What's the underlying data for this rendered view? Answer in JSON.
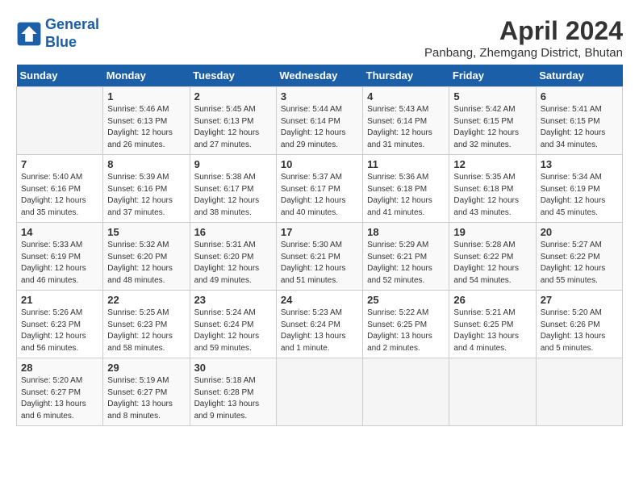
{
  "header": {
    "logo_line1": "General",
    "logo_line2": "Blue",
    "month": "April 2024",
    "location": "Panbang, Zhemgang District, Bhutan"
  },
  "weekdays": [
    "Sunday",
    "Monday",
    "Tuesday",
    "Wednesday",
    "Thursday",
    "Friday",
    "Saturday"
  ],
  "weeks": [
    [
      {
        "day": "",
        "info": ""
      },
      {
        "day": "1",
        "info": "Sunrise: 5:46 AM\nSunset: 6:13 PM\nDaylight: 12 hours\nand 26 minutes."
      },
      {
        "day": "2",
        "info": "Sunrise: 5:45 AM\nSunset: 6:13 PM\nDaylight: 12 hours\nand 27 minutes."
      },
      {
        "day": "3",
        "info": "Sunrise: 5:44 AM\nSunset: 6:14 PM\nDaylight: 12 hours\nand 29 minutes."
      },
      {
        "day": "4",
        "info": "Sunrise: 5:43 AM\nSunset: 6:14 PM\nDaylight: 12 hours\nand 31 minutes."
      },
      {
        "day": "5",
        "info": "Sunrise: 5:42 AM\nSunset: 6:15 PM\nDaylight: 12 hours\nand 32 minutes."
      },
      {
        "day": "6",
        "info": "Sunrise: 5:41 AM\nSunset: 6:15 PM\nDaylight: 12 hours\nand 34 minutes."
      }
    ],
    [
      {
        "day": "7",
        "info": "Sunrise: 5:40 AM\nSunset: 6:16 PM\nDaylight: 12 hours\nand 35 minutes."
      },
      {
        "day": "8",
        "info": "Sunrise: 5:39 AM\nSunset: 6:16 PM\nDaylight: 12 hours\nand 37 minutes."
      },
      {
        "day": "9",
        "info": "Sunrise: 5:38 AM\nSunset: 6:17 PM\nDaylight: 12 hours\nand 38 minutes."
      },
      {
        "day": "10",
        "info": "Sunrise: 5:37 AM\nSunset: 6:17 PM\nDaylight: 12 hours\nand 40 minutes."
      },
      {
        "day": "11",
        "info": "Sunrise: 5:36 AM\nSunset: 6:18 PM\nDaylight: 12 hours\nand 41 minutes."
      },
      {
        "day": "12",
        "info": "Sunrise: 5:35 AM\nSunset: 6:18 PM\nDaylight: 12 hours\nand 43 minutes."
      },
      {
        "day": "13",
        "info": "Sunrise: 5:34 AM\nSunset: 6:19 PM\nDaylight: 12 hours\nand 45 minutes."
      }
    ],
    [
      {
        "day": "14",
        "info": "Sunrise: 5:33 AM\nSunset: 6:19 PM\nDaylight: 12 hours\nand 46 minutes."
      },
      {
        "day": "15",
        "info": "Sunrise: 5:32 AM\nSunset: 6:20 PM\nDaylight: 12 hours\nand 48 minutes."
      },
      {
        "day": "16",
        "info": "Sunrise: 5:31 AM\nSunset: 6:20 PM\nDaylight: 12 hours\nand 49 minutes."
      },
      {
        "day": "17",
        "info": "Sunrise: 5:30 AM\nSunset: 6:21 PM\nDaylight: 12 hours\nand 51 minutes."
      },
      {
        "day": "18",
        "info": "Sunrise: 5:29 AM\nSunset: 6:21 PM\nDaylight: 12 hours\nand 52 minutes."
      },
      {
        "day": "19",
        "info": "Sunrise: 5:28 AM\nSunset: 6:22 PM\nDaylight: 12 hours\nand 54 minutes."
      },
      {
        "day": "20",
        "info": "Sunrise: 5:27 AM\nSunset: 6:22 PM\nDaylight: 12 hours\nand 55 minutes."
      }
    ],
    [
      {
        "day": "21",
        "info": "Sunrise: 5:26 AM\nSunset: 6:23 PM\nDaylight: 12 hours\nand 56 minutes."
      },
      {
        "day": "22",
        "info": "Sunrise: 5:25 AM\nSunset: 6:23 PM\nDaylight: 12 hours\nand 58 minutes."
      },
      {
        "day": "23",
        "info": "Sunrise: 5:24 AM\nSunset: 6:24 PM\nDaylight: 12 hours\nand 59 minutes."
      },
      {
        "day": "24",
        "info": "Sunrise: 5:23 AM\nSunset: 6:24 PM\nDaylight: 13 hours\nand 1 minute."
      },
      {
        "day": "25",
        "info": "Sunrise: 5:22 AM\nSunset: 6:25 PM\nDaylight: 13 hours\nand 2 minutes."
      },
      {
        "day": "26",
        "info": "Sunrise: 5:21 AM\nSunset: 6:25 PM\nDaylight: 13 hours\nand 4 minutes."
      },
      {
        "day": "27",
        "info": "Sunrise: 5:20 AM\nSunset: 6:26 PM\nDaylight: 13 hours\nand 5 minutes."
      }
    ],
    [
      {
        "day": "28",
        "info": "Sunrise: 5:20 AM\nSunset: 6:27 PM\nDaylight: 13 hours\nand 6 minutes."
      },
      {
        "day": "29",
        "info": "Sunrise: 5:19 AM\nSunset: 6:27 PM\nDaylight: 13 hours\nand 8 minutes."
      },
      {
        "day": "30",
        "info": "Sunrise: 5:18 AM\nSunset: 6:28 PM\nDaylight: 13 hours\nand 9 minutes."
      },
      {
        "day": "",
        "info": ""
      },
      {
        "day": "",
        "info": ""
      },
      {
        "day": "",
        "info": ""
      },
      {
        "day": "",
        "info": ""
      }
    ]
  ]
}
